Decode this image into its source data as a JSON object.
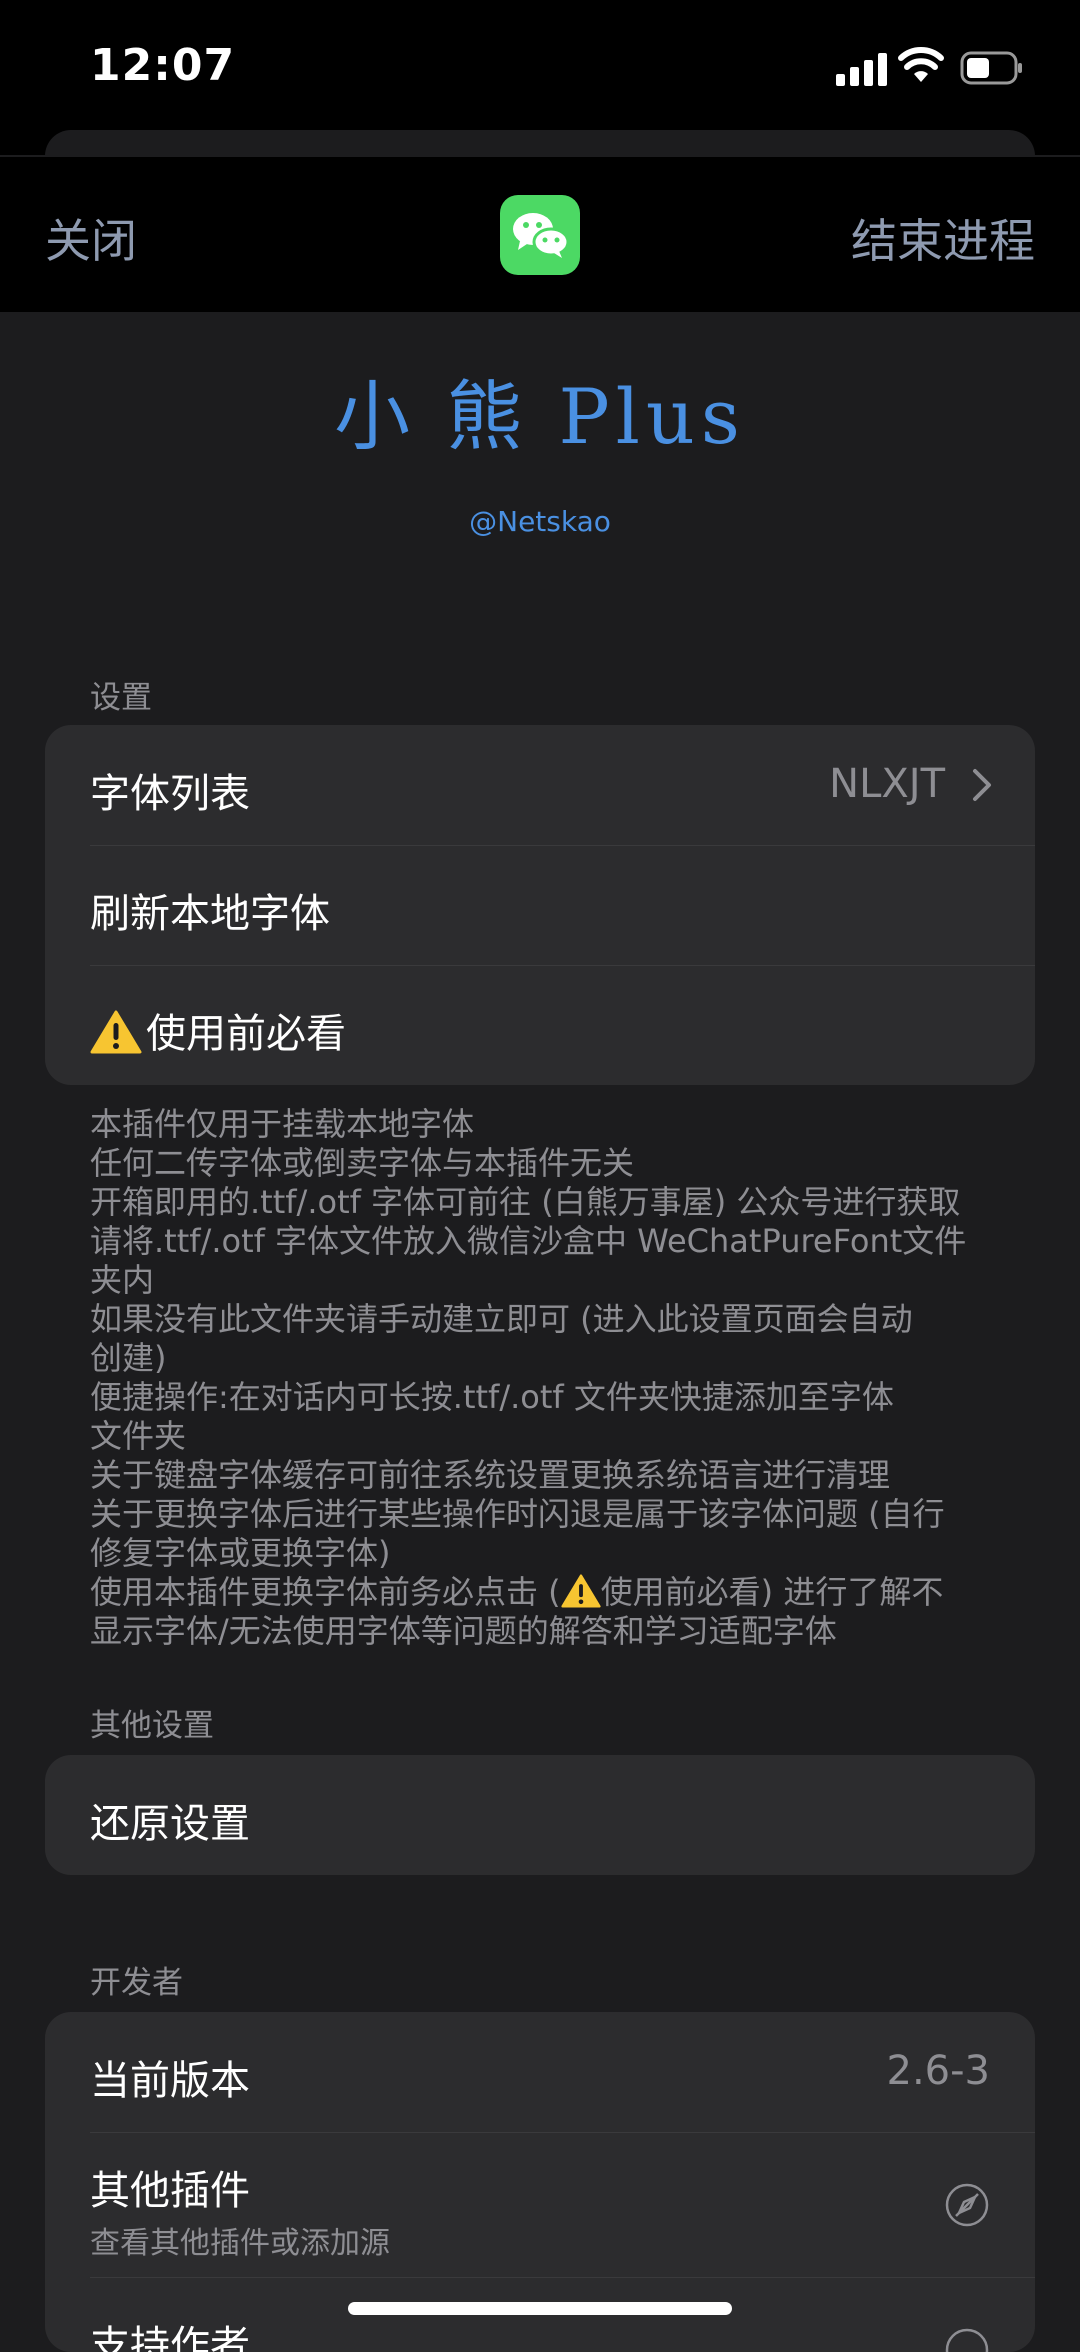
{
  "status_bar": {
    "time": "12:07"
  },
  "nav": {
    "close": "关闭",
    "end_process": "结束进程",
    "app_icon": "wechat-icon"
  },
  "banner": {
    "title": "小 熊 Plus",
    "subtitle": "@Netskao"
  },
  "settings": {
    "header": "设置",
    "font_list": {
      "label": "字体列表",
      "value": "NLXJT"
    },
    "refresh": {
      "label": "刷新本地字体"
    },
    "must_read": {
      "label": "使用前必看"
    }
  },
  "footer_lines": [
    "本插件仅用于挂载本地字体",
    "任何二传字体或倒卖字体与本插件无关",
    "开箱即用的.ttf/.otf 字体可前往 (白熊万事屋) 公众号进行获取",
    "请将.ttf/.otf 字体文件放入微信沙盒中 WeChatPureFont文件",
    "夹内",
    "如果没有此文件夹请手动建立即可 (进入此设置页面会自动",
    "创建)",
    "便捷操作:在对话内可长按.ttf/.otf 文件夹快捷添加至字体",
    "文件夹",
    "关于键盘字体缓存可前往系统设置更换系统语言进行清理",
    "关于更换字体后进行某些操作时闪退是属于该字体问题 (自行",
    "修复字体或更换字体)"
  ],
  "footer_warn": {
    "before": "使用本插件更换字体前务必点击 (",
    "after": "使用前必看) 进行了解不",
    "line2": "显示字体/无法使用字体等问题的解答和学习适配字体"
  },
  "other_settings": {
    "header": "其他设置",
    "reset": "还原设置"
  },
  "developer": {
    "header": "开发者",
    "version_label": "当前版本",
    "version_value": "2.6-3",
    "other_plugins": "其他插件",
    "other_plugins_sub": "查看其他插件或添加源",
    "support_author": "支持作者"
  }
}
